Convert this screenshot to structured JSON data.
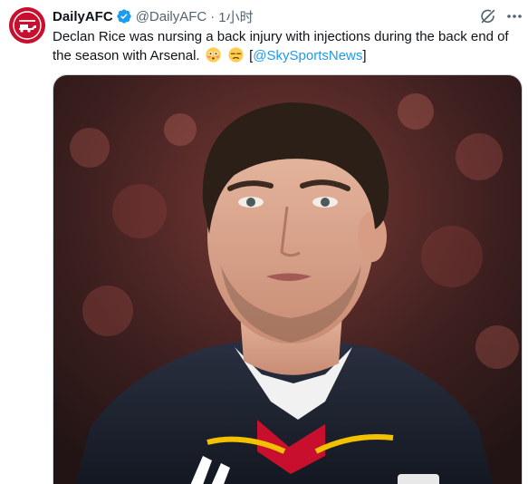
{
  "author": {
    "display_name": "DailyAFC",
    "handle": "@DailyAFC",
    "separator": "·",
    "timestamp": "1小时",
    "avatar_icon": "arsenal-crest-icon",
    "verified_icon": "verified-badge-icon",
    "verified_color": "#1d9bf0"
  },
  "actions": {
    "grok_icon": "grok-icon",
    "more_icon": "more-dots-icon"
  },
  "tweet": {
    "text_part1": "Declan Rice was nursing a back injury with injections during the back end of the season with Arsenal.",
    "emoji_1": "flushed-face-emoji",
    "emoji_2": "unamused-face-emoji",
    "bracket_open": "[",
    "mention": "@SkySportsNews",
    "bracket_close": "]",
    "link_color": "#1d9bf0"
  },
  "media": {
    "type": "photo",
    "subject": "player-portrait-photo"
  },
  "colors": {
    "brand_red": "#c8102e",
    "text_primary": "#0f1419",
    "text_secondary": "#536471"
  }
}
